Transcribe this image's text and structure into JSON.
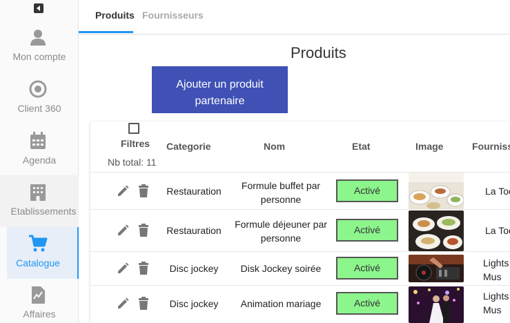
{
  "sidebar": {
    "items": [
      {
        "label": "Mon compte",
        "icon": "user-icon"
      },
      {
        "label": "Client 360",
        "icon": "target-icon"
      },
      {
        "label": "Agenda",
        "icon": "calendar-icon"
      },
      {
        "label": "Etablissements",
        "icon": "building-icon"
      },
      {
        "label": "Catalogue",
        "icon": "cart-icon"
      },
      {
        "label": "Affaires",
        "icon": "chart-doc-icon"
      }
    ],
    "active": "Catalogue",
    "accent": "#2196f3"
  },
  "tabs": [
    {
      "label": "Produits"
    },
    {
      "label": "Fournisseurs"
    }
  ],
  "page": {
    "title": "Produits",
    "add_button": "Ajouter un produit partenaire",
    "button_color": "#3f51b5"
  },
  "table": {
    "filters_label": "Filtres",
    "total": "Nb total: 11",
    "headers": [
      "Categorie",
      "Nom",
      "Etat",
      "Image",
      "Fourniss"
    ],
    "rows": [
      {
        "categorie": "Restauration",
        "nom": "Formule buffet par personne",
        "etat": "Activé",
        "fournisseur": "La Toc",
        "image": "buffet-photo"
      },
      {
        "categorie": "Restauration",
        "nom": "Formule déjeuner par personne",
        "etat": "Activé",
        "fournisseur": "La Toc",
        "image": "lunch-platter-photo"
      },
      {
        "categorie": "Disc jockey",
        "nom": "Disk Jockey soirée",
        "etat": "Activé",
        "fournisseur": "Lights Mus",
        "image": "dj-decks-photo"
      },
      {
        "categorie": "Disc jockey",
        "nom": "Animation mariage",
        "etat": "Activé",
        "fournisseur": "Lights Mus",
        "image": "wedding-dance-photo"
      }
    ],
    "status_color": "#8cf58c"
  }
}
